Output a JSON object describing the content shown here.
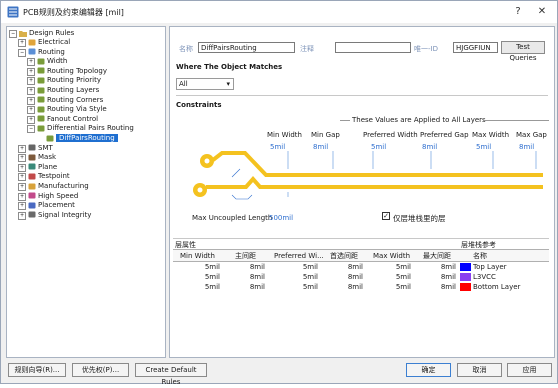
{
  "window": {
    "title": "PCB规则及约束编辑器 [mil]",
    "help_glyph": "?",
    "close_glyph": "✕"
  },
  "tree": {
    "root": "Design Rules",
    "items": [
      {
        "label": "Electrical",
        "icon": "electrical-icon",
        "expander": "+"
      },
      {
        "label": "Routing",
        "icon": "routing-icon",
        "expander": "−"
      },
      {
        "label": "Width",
        "icon": "rule-icon",
        "expander": "+"
      },
      {
        "label": "Routing Topology",
        "icon": "rule-icon",
        "expander": "+"
      },
      {
        "label": "Routing Priority",
        "icon": "rule-icon",
        "expander": "+"
      },
      {
        "label": "Routing Layers",
        "icon": "rule-icon",
        "expander": "+"
      },
      {
        "label": "Routing Corners",
        "icon": "rule-icon",
        "expander": "+"
      },
      {
        "label": "Routing Via Style",
        "icon": "rule-icon",
        "expander": "+"
      },
      {
        "label": "Fanout Control",
        "icon": "rule-icon",
        "expander": "+"
      },
      {
        "label": "Differential Pairs Routing",
        "icon": "rule-icon",
        "expander": "−"
      },
      {
        "label": "DiffPairsRouting",
        "icon": "rule-icon",
        "expander": ""
      },
      {
        "label": "SMT",
        "icon": "smt-icon",
        "expander": "+"
      },
      {
        "label": "Mask",
        "icon": "mask-icon",
        "expander": "+"
      },
      {
        "label": "Plane",
        "icon": "plane-icon",
        "expander": "+"
      },
      {
        "label": "Testpoint",
        "icon": "testpoint-icon",
        "expander": "+"
      },
      {
        "label": "Manufacturing",
        "icon": "manufacturing-icon",
        "expander": "+"
      },
      {
        "label": "High Speed",
        "icon": "highspeed-icon",
        "expander": "+"
      },
      {
        "label": "Placement",
        "icon": "placement-icon",
        "expander": "+"
      },
      {
        "label": "Signal Integrity",
        "icon": "signal-icon",
        "expander": "+"
      }
    ]
  },
  "rule": {
    "name_label": "名称",
    "name_value": "DiffPairsRouting",
    "comment_label": "注释",
    "comment_value": "",
    "uid_label": "唯一-ID",
    "uid_value": "HJGGFIUN",
    "test_queries": "Test Queries"
  },
  "matches": {
    "header": "Where The Object Matches",
    "select_value": "All"
  },
  "constraints": {
    "header": "Constraints",
    "applied_note": "These Values are Applied to All Layers",
    "columns": [
      {
        "label": "Min Width",
        "value": "5mil"
      },
      {
        "label": "Min Gap",
        "value": "8mil"
      },
      {
        "label": "Preferred Width",
        "value": "5mil"
      },
      {
        "label": "Preferred Gap",
        "value": "8mil"
      },
      {
        "label": "Max Width",
        "value": "5mil"
      },
      {
        "label": "Max Gap",
        "value": "8mil"
      }
    ],
    "max_uncoupled_label": "Max Uncoupled Length",
    "max_uncoupled_value": "500mil",
    "layer_stack_only": "仅层堆栈里的层",
    "layer_stack_checked": true
  },
  "layers_table": {
    "section_left": "层属性",
    "section_right": "层堆栈参考",
    "headers": [
      "Min Width",
      "主间距",
      "Preferred Wi...",
      "首选间距",
      "Max Width",
      "最大间距",
      "名称"
    ],
    "rows": [
      {
        "values": [
          "5mil",
          "8mil",
          "5mil",
          "8mil",
          "5mil",
          "8mil"
        ],
        "name": "Top Layer",
        "color": "#0000ff"
      },
      {
        "values": [
          "5mil",
          "8mil",
          "5mil",
          "8mil",
          "5mil",
          "8mil"
        ],
        "name": "L3VCC",
        "color": "#8a3ff0"
      },
      {
        "values": [
          "5mil",
          "8mil",
          "5mil",
          "8mil",
          "5mil",
          "8mil"
        ],
        "name": "Bottom Layer",
        "color": "#ff0000"
      }
    ]
  },
  "footer": {
    "rule_wizard": "规则向导(R)...",
    "priority": "优先权(P)...",
    "create_default": "Create Default Rules",
    "ok": "确定",
    "cancel": "取消",
    "apply": "应用"
  },
  "colors": {
    "trace": "#f4c21f",
    "selection": "#1f6fd0",
    "accent_text": "#2f6fcf"
  }
}
